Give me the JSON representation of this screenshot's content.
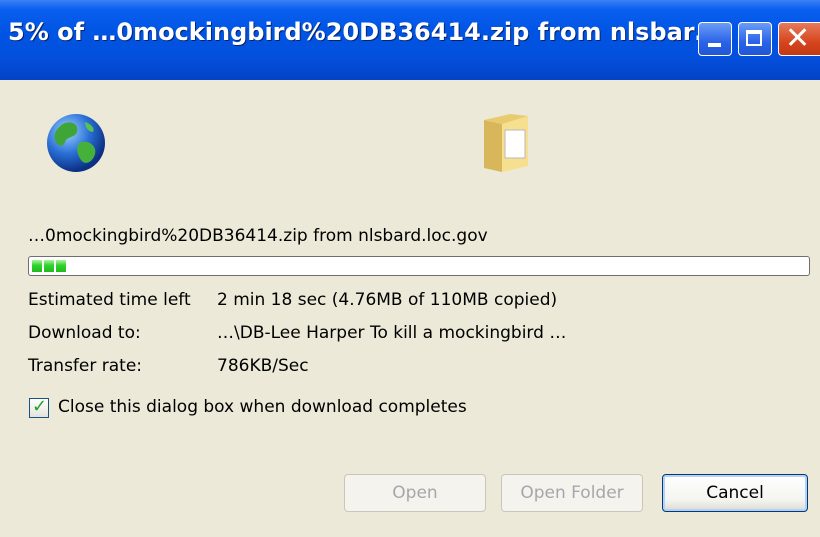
{
  "window": {
    "title": "5% of …0mockingbird%20DB36414.zip from nlsbar…",
    "progress_percent": 5,
    "colors": {
      "titlebar": "#0054e3",
      "progress": "#2ed22b",
      "body": "#ece9d8"
    }
  },
  "icons": {
    "source": "globe-icon",
    "destination": "folder-icon"
  },
  "download": {
    "filename_line": "…0mockingbird%20DB36414.zip from nlsbard.loc.gov",
    "progress_fraction": 0.0433
  },
  "details": {
    "estimated_label": "Estimated time left",
    "estimated_value": "2 min 18 sec (4.76MB of 110MB copied)",
    "download_to_label": "Download to:",
    "download_to_value": "…\\DB-Lee Harper To kill a mockingbird …",
    "rate_label": "Transfer rate:",
    "rate_value": "786KB/Sec"
  },
  "options": {
    "close_when_done_label": "Close this dialog box when download completes",
    "close_when_done_checked": true
  },
  "buttons": {
    "open_label": "Open",
    "open_folder_label": "Open Folder",
    "cancel_label": "Cancel"
  }
}
